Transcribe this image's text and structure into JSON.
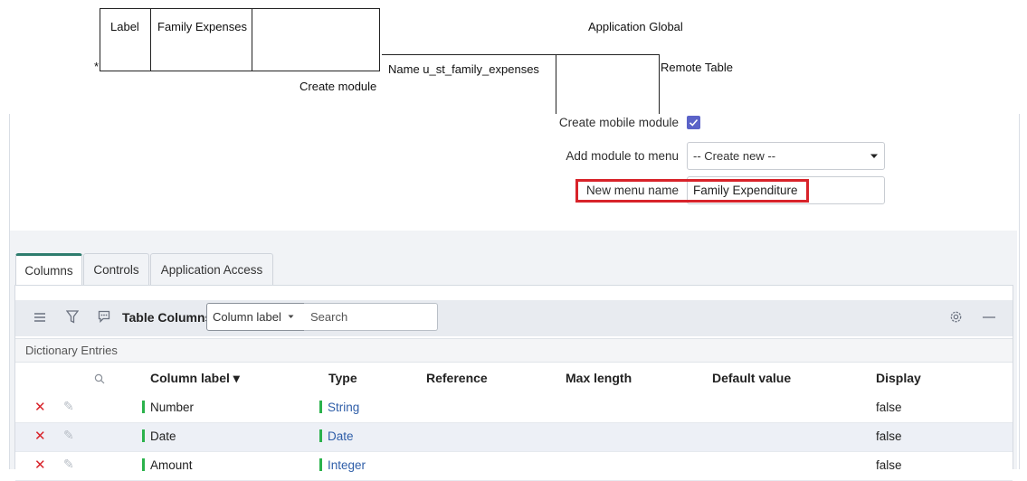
{
  "top_form": {
    "required_marker": "*",
    "label_caption": "Label",
    "label_value": "Family Expenses",
    "application": "Application Global",
    "name": "Name u_st_family_expenses",
    "remote_table": "Remote Table",
    "create_module": "Create module"
  },
  "module_form": {
    "create_mobile_module_label": "Create mobile module",
    "create_mobile_module_checked": true,
    "add_module_label": "Add module to menu",
    "add_module_value": "-- Create new --",
    "new_menu_name_label": "New menu name",
    "new_menu_name_value": "Family Expenditure",
    "highlight_color": "#d8232a"
  },
  "tabs": [
    {
      "label": "Columns",
      "active": true
    },
    {
      "label": "Controls",
      "active": false
    },
    {
      "label": "Application Access",
      "active": false
    }
  ],
  "list_toolbar": {
    "title": "Table Columns",
    "search_field_select": "Column label",
    "search_placeholder": "Search",
    "icons": [
      "menu-icon",
      "filter-icon",
      "speech-bubble-icon",
      "gear-icon",
      "minus-icon"
    ]
  },
  "list": {
    "section_label": "Dictionary Entries",
    "columns": [
      "Column label ▾",
      "Type",
      "Reference",
      "Max length",
      "Default value",
      "Display"
    ],
    "rows": [
      {
        "column_label": "Number",
        "type": "String",
        "display": "false"
      },
      {
        "column_label": "Date",
        "type": "Date",
        "display": "false"
      },
      {
        "column_label": "Amount",
        "type": "Integer",
        "display": "false"
      }
    ],
    "indicator_color": "#2bb24c",
    "link_color": "#2f5ea8"
  }
}
